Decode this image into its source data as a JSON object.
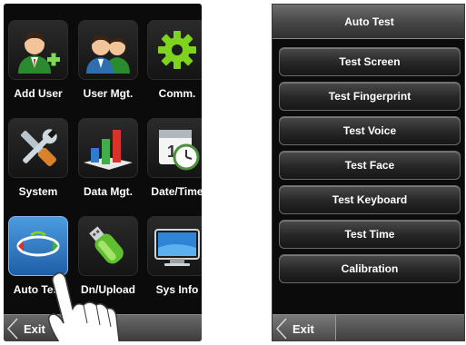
{
  "left_screen": {
    "tiles": [
      {
        "label": "Add User",
        "icon": "add-user-icon"
      },
      {
        "label": "User Mgt.",
        "icon": "user-management-icon"
      },
      {
        "label": "Comm.",
        "icon": "gear-icon"
      },
      {
        "label": "System",
        "icon": "tools-icon"
      },
      {
        "label": "Data Mgt.",
        "icon": "bar-chart-icon"
      },
      {
        "label": "Date/Time",
        "icon": "calendar-clock-icon"
      },
      {
        "label": "Auto Test",
        "icon": "auto-test-icon"
      },
      {
        "label": "Dn/Upload",
        "icon": "usb-drive-icon"
      },
      {
        "label": "Sys Info",
        "icon": "monitor-icon"
      }
    ],
    "exit_label": "Exit"
  },
  "right_screen": {
    "title": "Auto Test",
    "buttons": [
      "Test Screen",
      "Test Fingerprint",
      "Test Voice",
      "Test Face",
      "Test Keyboard",
      "Test Time",
      "Calibration"
    ],
    "exit_label": "Exit"
  },
  "colors": {
    "screen_bg": "#0b0b0b",
    "active_tile": "#2f7ccc",
    "bar_gray": "#555555"
  }
}
